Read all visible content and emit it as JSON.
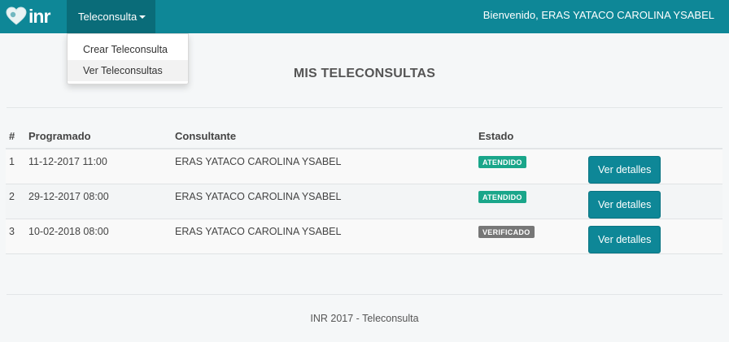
{
  "navbar": {
    "brand": "inr",
    "menu_label": "Teleconsulta",
    "welcome": "Bienvenido, ERAS YATACO CAROLINA YSABEL",
    "color": "#0e8797"
  },
  "dropdown": {
    "items": [
      {
        "label": "Crear Teleconsulta"
      },
      {
        "label": "Ver Teleconsultas"
      }
    ]
  },
  "page": {
    "title": "MIS TELECONSULTAS"
  },
  "table": {
    "headers": [
      "#",
      "Programado",
      "Consultante",
      "Estado",
      ""
    ],
    "rows": [
      {
        "num": "1",
        "programado": "11-12-2017 11:00",
        "consultante": "ERAS YATACO CAROLINA YSABEL",
        "estado": "ATENDIDO",
        "accion": "Ver detalles"
      },
      {
        "num": "2",
        "programado": "29-12-2017 08:00",
        "consultante": "ERAS YATACO CAROLINA YSABEL",
        "estado": "ATENDIDO",
        "accion": "Ver detalles"
      },
      {
        "num": "3",
        "programado": "10-02-2018 08:00",
        "consultante": "ERAS YATACO CAROLINA YSABEL",
        "estado": "VERIFICADO",
        "accion": "Ver detalles"
      }
    ]
  },
  "footer": {
    "text": "INR 2017 - Teleconsulta"
  }
}
